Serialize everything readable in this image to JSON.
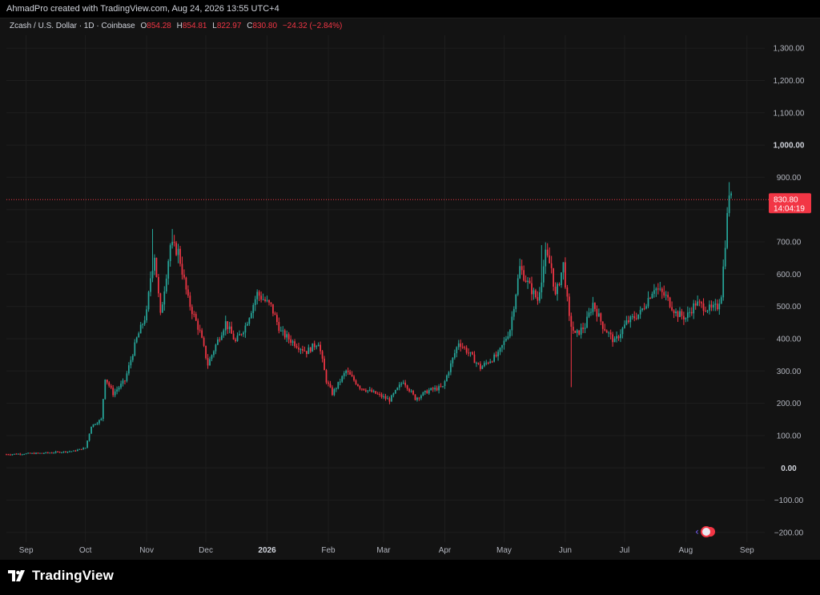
{
  "header": {
    "attribution": "AhmadPro created with TradingView.com, Aug 24, 2026 13:55 UTC+4"
  },
  "legend": {
    "symbol": "Zcash / U.S. Dollar · 1D · Coinbase",
    "open_label": "O",
    "open": "854.28",
    "high_label": "H",
    "high": "854.81",
    "low_label": "L",
    "low": "822.97",
    "close_label": "C",
    "close": "830.80",
    "change": "−24.32 (−2.84%)"
  },
  "price_badge": {
    "price": "830.80",
    "countdown": "14:04:19"
  },
  "brand": {
    "name": "TradingView"
  },
  "colors": {
    "up": "#26a69a",
    "down": "#f23645",
    "background": "#131313",
    "grid": "#1e1e1e",
    "text": "#b2b5be"
  },
  "chart_data": {
    "type": "candlestick",
    "symbol": "ZEC/USD",
    "interval": "1D",
    "exchange": "Coinbase",
    "y_ticks": [
      "1,300.00",
      "1,200.00",
      "1,100.00",
      "1,000.00",
      "900.00",
      "800.00",
      "700.00",
      "600.00",
      "500.00",
      "400.00",
      "300.00",
      "200.00",
      "100.00",
      "0.00",
      "−100.00",
      "−200.00"
    ],
    "y_tick_values": [
      1300,
      1200,
      1100,
      1000,
      900,
      800,
      700,
      600,
      500,
      400,
      300,
      200,
      100,
      0,
      -100,
      -200
    ],
    "bold_ticks": [
      "1,000.00",
      "0.00"
    ],
    "ylim": [
      -230,
      1340
    ],
    "x_start": "2025-08-22",
    "x_end": "2026-09-10",
    "x_ticks": [
      {
        "label": "Sep",
        "date": "2025-09-01"
      },
      {
        "label": "Oct",
        "date": "2025-10-01"
      },
      {
        "label": "Nov",
        "date": "2025-11-01"
      },
      {
        "label": "Dec",
        "date": "2025-12-01"
      },
      {
        "label": "2026",
        "date": "2026-01-01",
        "bold": true
      },
      {
        "label": "Feb",
        "date": "2026-02-01"
      },
      {
        "label": "Mar",
        "date": "2026-03-01"
      },
      {
        "label": "Apr",
        "date": "2026-04-01"
      },
      {
        "label": "May",
        "date": "2026-05-01"
      },
      {
        "label": "Jun",
        "date": "2026-06-01"
      },
      {
        "label": "Jul",
        "date": "2026-07-01"
      },
      {
        "label": "Aug",
        "date": "2026-08-01"
      },
      {
        "label": "Sep",
        "date": "2026-09-01"
      }
    ],
    "last_price": 830.8,
    "key_points": [
      {
        "date": "2025-08-22",
        "close": 42
      },
      {
        "date": "2025-09-10",
        "close": 46
      },
      {
        "date": "2025-09-25",
        "close": 52
      },
      {
        "date": "2025-10-01",
        "close": 62
      },
      {
        "date": "2025-10-04",
        "close": 130
      },
      {
        "date": "2025-10-09",
        "close": 150
      },
      {
        "date": "2025-10-11",
        "close": 280
      },
      {
        "date": "2025-10-15",
        "close": 230
      },
      {
        "date": "2025-10-21",
        "close": 270
      },
      {
        "date": "2025-10-27",
        "close": 400
      },
      {
        "date": "2025-11-01",
        "close": 480
      },
      {
        "date": "2025-11-03",
        "close": 590
      },
      {
        "date": "2025-11-05",
        "close": 660
      },
      {
        "date": "2025-11-08",
        "close": 470
      },
      {
        "date": "2025-11-13",
        "close": 690
      },
      {
        "date": "2025-11-17",
        "close": 670
      },
      {
        "date": "2025-11-22",
        "close": 520
      },
      {
        "date": "2025-11-28",
        "close": 420
      },
      {
        "date": "2025-12-02",
        "close": 320
      },
      {
        "date": "2025-12-06",
        "close": 380
      },
      {
        "date": "2025-12-11",
        "close": 450
      },
      {
        "date": "2025-12-16",
        "close": 390
      },
      {
        "date": "2025-12-21",
        "close": 440
      },
      {
        "date": "2025-12-27",
        "close": 540
      },
      {
        "date": "2026-01-03",
        "close": 500
      },
      {
        "date": "2026-01-08",
        "close": 420
      },
      {
        "date": "2026-01-14",
        "close": 390
      },
      {
        "date": "2026-01-21",
        "close": 360
      },
      {
        "date": "2026-01-27",
        "close": 390
      },
      {
        "date": "2026-01-31",
        "close": 270
      },
      {
        "date": "2026-02-03",
        "close": 230
      },
      {
        "date": "2026-02-10",
        "close": 300
      },
      {
        "date": "2026-02-17",
        "close": 250
      },
      {
        "date": "2026-02-25",
        "close": 230
      },
      {
        "date": "2026-03-04",
        "close": 210
      },
      {
        "date": "2026-03-11",
        "close": 270
      },
      {
        "date": "2026-03-17",
        "close": 215
      },
      {
        "date": "2026-03-24",
        "close": 240
      },
      {
        "date": "2026-03-31",
        "close": 250
      },
      {
        "date": "2026-04-08",
        "close": 390
      },
      {
        "date": "2026-04-14",
        "close": 350
      },
      {
        "date": "2026-04-19",
        "close": 310
      },
      {
        "date": "2026-04-23",
        "close": 330
      },
      {
        "date": "2026-04-28",
        "close": 350
      },
      {
        "date": "2026-05-04",
        "close": 430
      },
      {
        "date": "2026-05-09",
        "close": 620
      },
      {
        "date": "2026-05-14",
        "close": 560
      },
      {
        "date": "2026-05-18",
        "close": 520
      },
      {
        "date": "2026-05-22",
        "close": 660
      },
      {
        "date": "2026-05-25",
        "close": 620
      },
      {
        "date": "2026-05-27",
        "close": 530
      },
      {
        "date": "2026-05-31",
        "close": 630
      },
      {
        "date": "2026-06-03",
        "close": 460
      },
      {
        "date": "2026-06-06",
        "close": 410
      },
      {
        "date": "2026-06-11",
        "close": 440
      },
      {
        "date": "2026-06-15",
        "close": 510
      },
      {
        "date": "2026-06-20",
        "close": 440
      },
      {
        "date": "2026-06-26",
        "close": 390
      },
      {
        "date": "2026-07-02",
        "close": 450
      },
      {
        "date": "2026-07-09",
        "close": 480
      },
      {
        "date": "2026-07-16",
        "close": 560
      },
      {
        "date": "2026-07-22",
        "close": 530
      },
      {
        "date": "2026-07-27",
        "close": 480
      },
      {
        "date": "2026-08-01",
        "close": 465
      },
      {
        "date": "2026-08-06",
        "close": 510
      },
      {
        "date": "2026-08-10",
        "close": 500
      },
      {
        "date": "2026-08-14",
        "close": 490
      },
      {
        "date": "2026-08-17",
        "close": 500
      },
      {
        "date": "2026-08-19",
        "close": 540
      },
      {
        "date": "2026-08-21",
        "close": 700
      },
      {
        "date": "2026-08-23",
        "close": 855
      },
      {
        "date": "2026-08-24",
        "close": 830.8
      }
    ],
    "spikes": [
      {
        "date": "2025-11-04",
        "high": 740
      },
      {
        "date": "2025-11-14",
        "high": 740
      },
      {
        "date": "2026-05-20",
        "high": 690
      },
      {
        "date": "2026-06-04",
        "low": 250
      },
      {
        "date": "2026-08-23",
        "high": 885
      }
    ]
  }
}
